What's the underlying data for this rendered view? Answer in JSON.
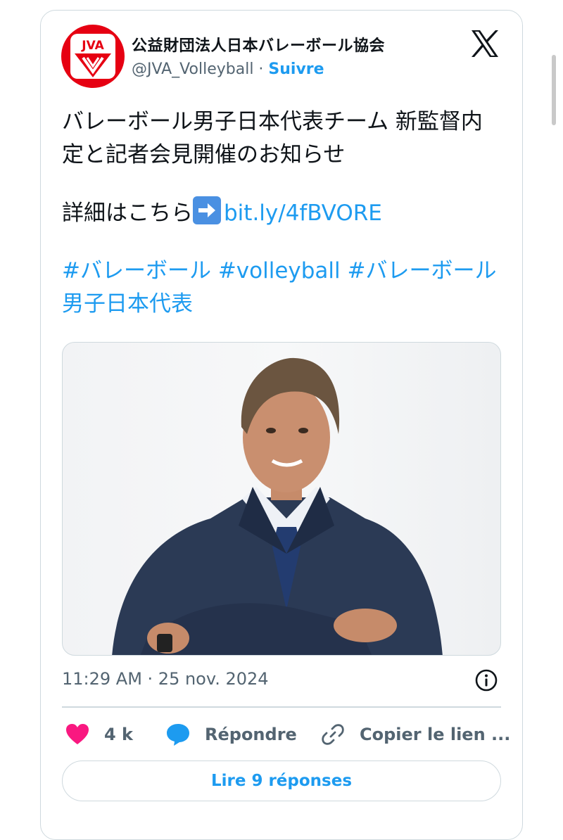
{
  "author": {
    "name": "公益財団法人日本バレーボール協会",
    "handle": "@JVA_Volleyball",
    "separator": " · ",
    "follow_label": "Suivre",
    "avatar_text": "JVA"
  },
  "tweet": {
    "line1": "バレーボール男子日本代表チーム 新監督内定と記者会見開催のお知らせ",
    "details_prefix": "詳細はこちら",
    "link_text": "bit.ly/4fBVORE",
    "hashtags": "#バレーボール #volleyball #バレーボール男子日本代表"
  },
  "meta": {
    "timestamp": "11:29 AM · 25 nov. 2024"
  },
  "actions": {
    "like_count": "4 k",
    "reply_label": "Répondre",
    "copy_label": "Copier le lien ..."
  },
  "read_replies_label": "Lire 9 réponses",
  "colors": {
    "accent": "#1d9bf0",
    "like": "#f91880",
    "brand_red": "#e60012"
  }
}
